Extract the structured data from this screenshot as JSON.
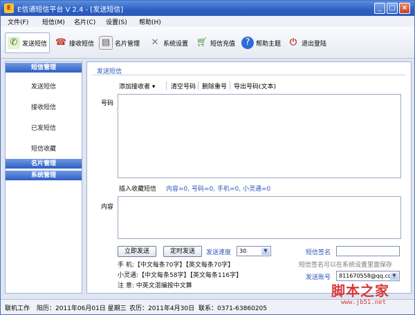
{
  "window": {
    "title": "E信通短信平台 V  2.4 - [发送短信]"
  },
  "menu": [
    "文件(F)",
    "短信(M)",
    "名片(C)",
    "设置(S)",
    "帮助(H)"
  ],
  "toolbar": {
    "send": "发送短信",
    "receive": "接收短信",
    "cards": "名片管理",
    "settings": "系统设置",
    "recharge": "短信充值",
    "help": "帮助主题",
    "logout": "退出登陆"
  },
  "left": {
    "sms_header": "短信管理",
    "items": [
      "发送短信",
      "接收短信",
      "已发短信",
      "短信收藏"
    ],
    "cards_header": "名片管理",
    "system_header": "系统管理"
  },
  "main": {
    "title": "发送短信",
    "add_recipient": "添加接收者",
    "clear_numbers": "清空号码",
    "delete_dupes": "删除重号",
    "export_numbers": "导出号码(文本)",
    "number_label": "号码",
    "insert_fav": "插入收藏短信",
    "counts": "内容=0, 号码=0, 手机=0, 小灵通=0",
    "content_label": "内容",
    "send_now": "立即发送",
    "schedule_send": "定时发送",
    "speed_label": "发送速度",
    "speed_value": "30",
    "sig_label": "短信签名",
    "sig_value": "",
    "sig_hint": "短信签名可以在系统设置里面保存",
    "account_label": "发送账号",
    "account_value": "811670558@qq.com",
    "rule_mobile": "手  机:【中文每条70字】【英文每条70字】",
    "rule_phs": "小灵通:【中文每条58字】【英文每条116字】",
    "note": "注  意: 中英文混编按中文算"
  },
  "status": {
    "mode": "联机工作",
    "solar": "阳历：2011年06月01日 星期三",
    "lunar": "农历：2011年4月30日",
    "contact": "联系：0371-63860205"
  },
  "watermark": {
    "text": "脚本之家",
    "url": "www.jb51.net"
  }
}
